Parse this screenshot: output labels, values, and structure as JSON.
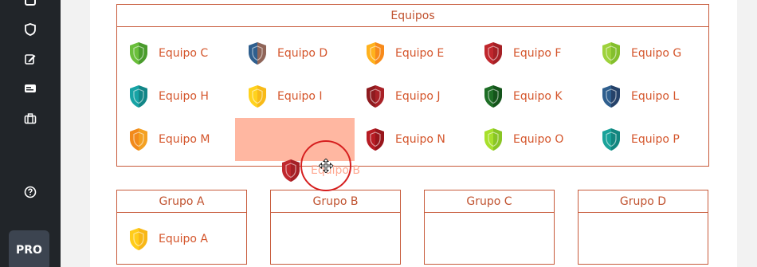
{
  "sidebar": {
    "icons": [
      "square-icon",
      "shield-icon",
      "edit-icon",
      "card-icon",
      "briefcase-icon",
      "help-icon"
    ],
    "pro_label": "PRO"
  },
  "equipos": {
    "title": "Equipos",
    "teams": [
      {
        "name": "Equipo C",
        "color": "#6abf3b",
        "accent": "#2f7d22"
      },
      {
        "name": "Equipo D",
        "color": "#2f5f8e",
        "accent": "#e06a2b"
      },
      {
        "name": "Equipo E",
        "color": "#ffb21e",
        "accent": "#f06a1a"
      },
      {
        "name": "Equipo F",
        "color": "#c0272d",
        "accent": "#8e1b1f"
      },
      {
        "name": "Equipo G",
        "color": "#9ed23c",
        "accent": "#6fae21"
      },
      {
        "name": "Equipo H",
        "color": "#17a3a5",
        "accent": "#0e6f70"
      },
      {
        "name": "Equipo I",
        "color": "#ffd21e",
        "accent": "#f3a514"
      },
      {
        "name": "Equipo J",
        "color": "#8e1b1f",
        "accent": "#c0272d"
      },
      {
        "name": "Equipo K",
        "color": "#1e6e26",
        "accent": "#0d3f12"
      },
      {
        "name": "Equipo L",
        "color": "#2f5f8e",
        "accent": "#1d2a4a"
      },
      {
        "name": "Equipo M",
        "color": "#f28a1a",
        "accent": "#f6b52a"
      },
      {
        "name": "Equipo N",
        "color": "#b71c24",
        "accent": "#7f1016"
      },
      {
        "name": "Equipo O",
        "color": "#a8e02c",
        "accent": "#6fae21"
      },
      {
        "name": "Equipo P",
        "color": "#1aa39a",
        "accent": "#0d6f69"
      }
    ]
  },
  "dragging": {
    "name": "Equipo B",
    "color": "#c0272d",
    "accent": "#8e1b1f"
  },
  "groups": [
    {
      "title": "Grupo A",
      "teams": [
        {
          "name": "Equipo A",
          "color": "#ffcc1a",
          "accent": "#f3a514"
        }
      ]
    },
    {
      "title": "Grupo B",
      "teams": []
    },
    {
      "title": "Grupo C",
      "teams": []
    },
    {
      "title": "Grupo D",
      "teams": []
    }
  ]
}
